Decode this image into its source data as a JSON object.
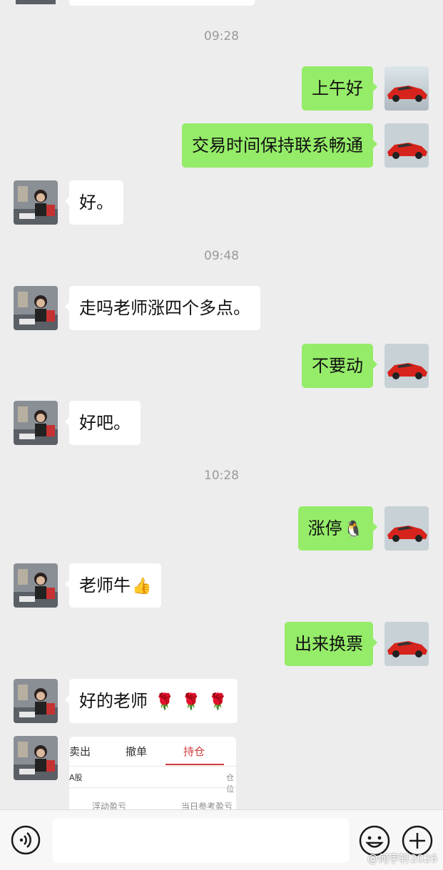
{
  "messages": [
    {
      "type": "time",
      "text": "09:28"
    },
    {
      "type": "msg",
      "side": "mine",
      "text": "上午好"
    },
    {
      "type": "msg",
      "side": "mine",
      "text": "交易时间保持联系畅通"
    },
    {
      "type": "msg",
      "side": "theirs",
      "text": "好。"
    },
    {
      "type": "time",
      "text": "09:48"
    },
    {
      "type": "msg",
      "side": "theirs",
      "text": "走吗老师涨四个多点。"
    },
    {
      "type": "msg",
      "side": "mine",
      "text": "不要动"
    },
    {
      "type": "msg",
      "side": "theirs",
      "text": "好吧。"
    },
    {
      "type": "time",
      "text": "10:28"
    },
    {
      "type": "msg",
      "side": "mine",
      "text": "涨停",
      "emoji": "🐧"
    },
    {
      "type": "msg",
      "side": "theirs",
      "text": "老师牛",
      "emoji": "👍"
    },
    {
      "type": "msg",
      "side": "mine",
      "text": "出来换票"
    },
    {
      "type": "msg",
      "side": "theirs",
      "text": "好的老师",
      "roses": [
        "🌹",
        "🌹",
        "🌹"
      ]
    }
  ],
  "card": {
    "tabs": [
      "卖出",
      "撤单",
      "持仓"
    ],
    "active_tab": "持仓",
    "market": "A股",
    "position_cut": "仓位",
    "col_float": "浮动盈亏",
    "col_daily": "当日参考盈亏"
  },
  "input": {
    "placeholder": ""
  },
  "icons": {
    "voice": "voice-icon",
    "emoji": "emoji-icon",
    "plus": "plus-icon"
  },
  "watermark": "@何宇轩2026",
  "colors": {
    "background": "#ededed",
    "mine_bubble": "#95ec69",
    "theirs_bubble": "#ffffff",
    "active_tab": "#d23a3a"
  }
}
